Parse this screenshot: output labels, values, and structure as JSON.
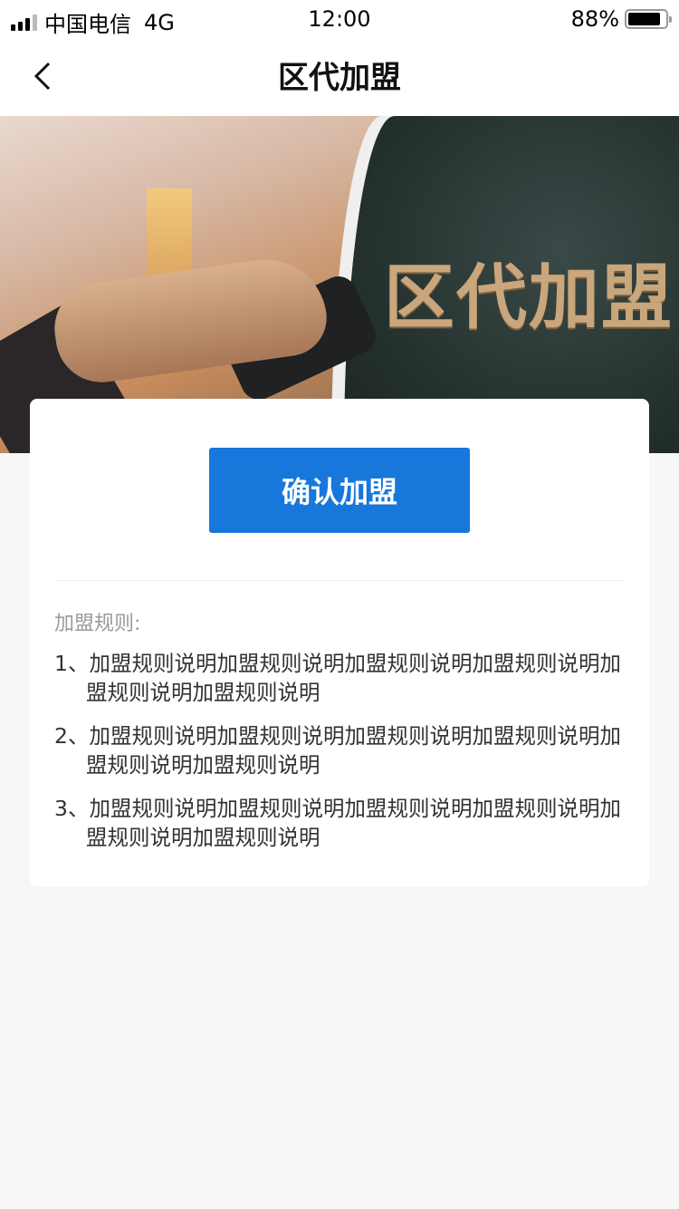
{
  "status_bar": {
    "carrier": "中国电信",
    "network": "4G",
    "time": "12:00",
    "battery_percent": "88%",
    "battery_level": 0.88,
    "signal_bars": 3
  },
  "nav": {
    "title": "区代加盟",
    "back_icon": "chevron-left-icon"
  },
  "banner": {
    "logo_text": "区代加盟"
  },
  "card": {
    "confirm_label": "确认加盟",
    "rules_title": "加盟规则:",
    "rules": [
      {
        "index": "1、",
        "text": "加盟规则说明加盟规则说明加盟规则说明加盟规则说明加盟规则说明加盟规则说明"
      },
      {
        "index": "2、",
        "text": "加盟规则说明加盟规则说明加盟规则说明加盟规则说明加盟规则说明加盟规则说明"
      },
      {
        "index": "3、",
        "text": "加盟规则说明加盟规则说明加盟规则说明加盟规则说明加盟规则说明加盟规则说明"
      }
    ]
  },
  "colors": {
    "accent": "#1777db",
    "background": "#f7f7f7"
  }
}
